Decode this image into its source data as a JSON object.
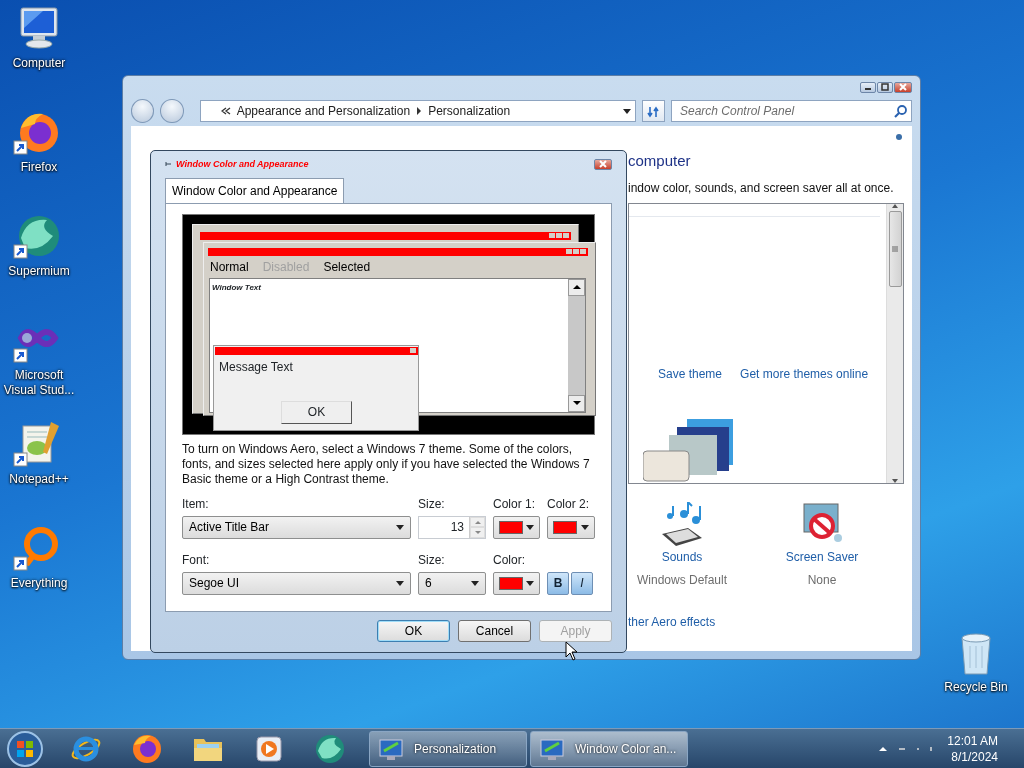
{
  "desktop_icons": [
    {
      "label": "Computer",
      "kind": "computer",
      "shortcut": false
    },
    {
      "label": "Firefox",
      "kind": "firefox",
      "shortcut": true
    },
    {
      "label": "Supermium",
      "kind": "supermium",
      "shortcut": true
    },
    {
      "label": "Microsoft Visual Stud...",
      "kind": "studio",
      "shortcut": true
    },
    {
      "label": "Notepad++",
      "kind": "notepad",
      "shortcut": true
    },
    {
      "label": "Everything",
      "kind": "everything",
      "shortcut": true
    }
  ],
  "recycle_bin": {
    "label": "Recycle Bin"
  },
  "control_panel": {
    "breadcrumb": [
      "Appearance and Personalization",
      "Personalization"
    ],
    "search": {
      "placeholder": "Search Control Panel"
    },
    "heading": "computer",
    "description": "indow color, sounds, and screen saver all at once.",
    "theme_links": [
      "Save theme",
      "Get more themes online"
    ],
    "settings": [
      {
        "label": "Sounds",
        "value": "Windows Default",
        "kind": "sounds"
      },
      {
        "label": "Screen Saver",
        "value": "None",
        "kind": "screensaver"
      }
    ],
    "aero_link": "ther Aero effects"
  },
  "dialog": {
    "title": "Window Color and Appearance",
    "tabs": [
      {
        "label": "Window Color and Appearance",
        "selected": true
      }
    ],
    "preview": {
      "menu": [
        {
          "label": "Normal",
          "kind": "normal"
        },
        {
          "label": "Disabled",
          "kind": "disabled"
        },
        {
          "label": "Selected",
          "kind": "selected"
        }
      ],
      "window_text": "Window Text",
      "message_text": "Message Text",
      "ok": "OK"
    },
    "note": "To turn on Windows Aero, select a Windows 7 theme.  Some of the colors, fonts, and sizes selected here apply only if you have selected the Windows 7 Basic theme or a High Contrast theme.",
    "item": {
      "label": "Item:",
      "value": "Active Title Bar"
    },
    "item_size": {
      "label": "Size:",
      "value": "13"
    },
    "color1": {
      "label": "Color 1:",
      "color": "#ff0000"
    },
    "color2": {
      "label": "Color 2:",
      "color": "#ff0000"
    },
    "font": {
      "label": "Font:",
      "value": "Segoe UI"
    },
    "font_size": {
      "label": "Size:",
      "value": "6"
    },
    "font_color": {
      "label": "Color:",
      "color": "#ff0000"
    },
    "bold": {
      "label": "B",
      "on": true
    },
    "italic": {
      "label": "I",
      "on": true
    },
    "buttons": [
      {
        "label": "OK",
        "kind": "default",
        "disabled": false
      },
      {
        "label": "Cancel",
        "kind": "normal",
        "disabled": false
      },
      {
        "label": "Apply",
        "kind": "normal",
        "disabled": true
      }
    ]
  },
  "taskbar": {
    "pinned": [
      {
        "kind": "ie"
      },
      {
        "kind": "firefox"
      },
      {
        "kind": "folder"
      },
      {
        "kind": "media"
      },
      {
        "kind": "supermium"
      }
    ],
    "tasks": [
      {
        "label": "Personalization",
        "selected": false
      },
      {
        "label": "Window Color an...",
        "selected": true
      }
    ],
    "clock": {
      "time": "12:01 AM",
      "date": "8/1/2024"
    }
  }
}
